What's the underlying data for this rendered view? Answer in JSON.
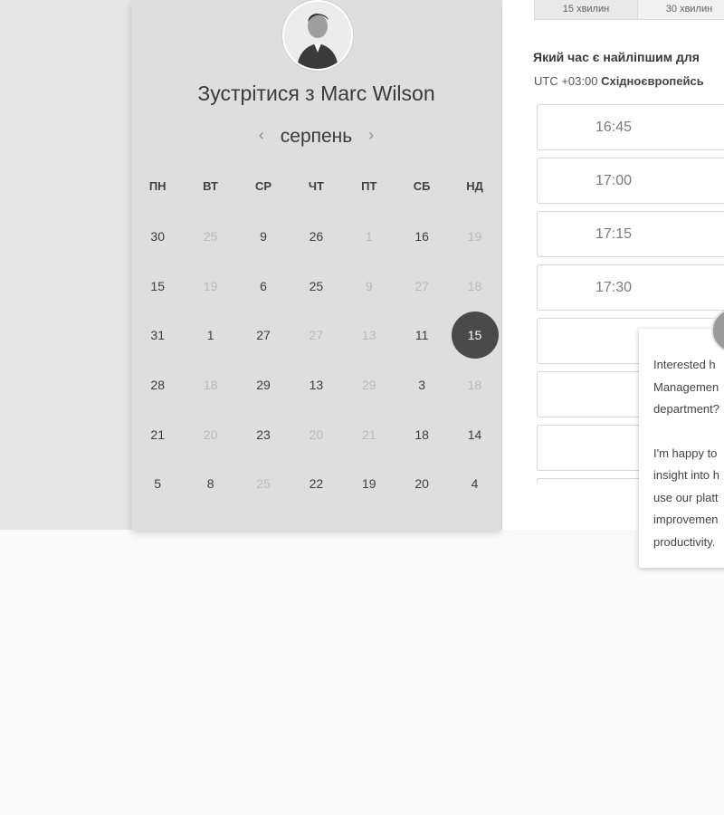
{
  "meeting": {
    "title_prefix": "Зустрітися з",
    "host_name": "Marc Wilson"
  },
  "calendar": {
    "month": "серпень",
    "weekdays": [
      "ПН",
      "ВТ",
      "СР",
      "ЧТ",
      "ПТ",
      "СБ",
      "НД"
    ],
    "weeks": [
      [
        {
          "d": "30",
          "muted": false
        },
        {
          "d": "25",
          "muted": true
        },
        {
          "d": "9",
          "muted": false
        },
        {
          "d": "26",
          "muted": false
        },
        {
          "d": "1",
          "muted": true
        },
        {
          "d": "16",
          "muted": false
        },
        {
          "d": "19",
          "muted": true
        }
      ],
      [
        {
          "d": "15",
          "muted": false
        },
        {
          "d": "19",
          "muted": true
        },
        {
          "d": "6",
          "muted": false
        },
        {
          "d": "25",
          "muted": false
        },
        {
          "d": "9",
          "muted": true
        },
        {
          "d": "27",
          "muted": true
        },
        {
          "d": "18",
          "muted": true
        }
      ],
      [
        {
          "d": "31",
          "muted": false
        },
        {
          "d": "1",
          "muted": false
        },
        {
          "d": "27",
          "muted": false
        },
        {
          "d": "27",
          "muted": true
        },
        {
          "d": "13",
          "muted": true
        },
        {
          "d": "11",
          "muted": false
        },
        {
          "d": "15",
          "muted": false,
          "selected": true
        }
      ],
      [
        {
          "d": "28",
          "muted": false
        },
        {
          "d": "18",
          "muted": true
        },
        {
          "d": "29",
          "muted": false
        },
        {
          "d": "13",
          "muted": false
        },
        {
          "d": "29",
          "muted": true
        },
        {
          "d": "3",
          "muted": false
        },
        {
          "d": "18",
          "muted": true
        }
      ],
      [
        {
          "d": "21",
          "muted": false
        },
        {
          "d": "20",
          "muted": true
        },
        {
          "d": "23",
          "muted": false
        },
        {
          "d": "20",
          "muted": true
        },
        {
          "d": "21",
          "muted": true
        },
        {
          "d": "18",
          "muted": false
        },
        {
          "d": "14",
          "muted": false
        }
      ],
      [
        {
          "d": "5",
          "muted": false
        },
        {
          "d": "8",
          "muted": false
        },
        {
          "d": "25",
          "muted": true
        },
        {
          "d": "22",
          "muted": false
        },
        {
          "d": "19",
          "muted": false
        },
        {
          "d": "20",
          "muted": false
        },
        {
          "d": "4",
          "muted": false
        }
      ]
    ]
  },
  "duration_tabs": [
    "15 хвилин",
    "30 хвилин"
  ],
  "time_panel": {
    "question": "Який час є найліпшим для",
    "timezone_offset": "UTC +03:00",
    "timezone_name": "Східноєвропейсь",
    "slots": [
      "16:45",
      "17:00",
      "17:15",
      "17:30",
      "",
      "",
      "",
      ""
    ]
  },
  "chat_popup": {
    "message_1": "Interested h\nManagemen\ndepartment?",
    "message_2": "I'm happy to\ninsight into h\nuse our platt\nimprovemen\nproductivity."
  },
  "colors": {
    "selected_day_bg": "#4a4a4a",
    "muted_day": "#b9b9b9"
  },
  "icons": {
    "prev_month": "chevron-left-icon",
    "next_month": "chevron-right-icon"
  }
}
